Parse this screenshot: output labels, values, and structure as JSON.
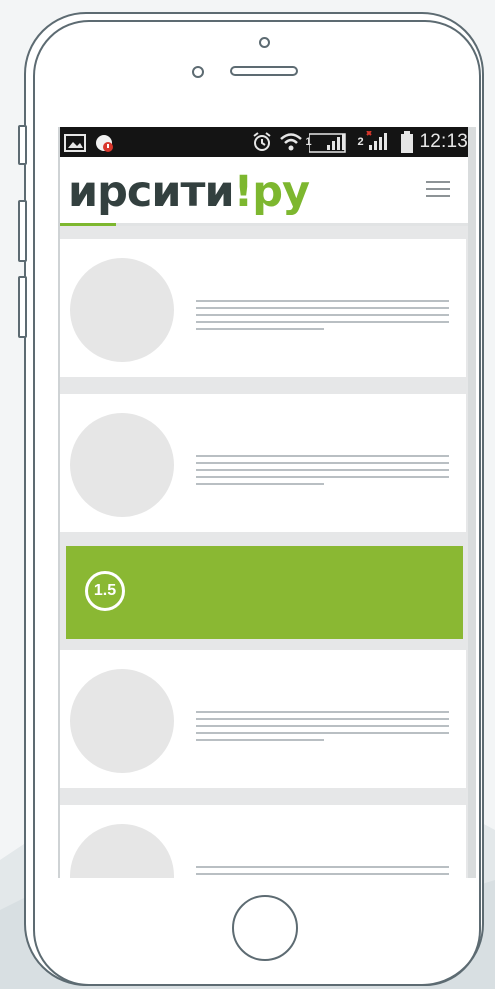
{
  "status_bar": {
    "time": "12:13",
    "sim1_label": "1",
    "sim2_label": "2",
    "icons": [
      "image-icon",
      "notification-icon",
      "alarm-icon",
      "wifi-icon",
      "signal-sim1-icon",
      "signal-sim2-icon",
      "battery-icon"
    ]
  },
  "header": {
    "logo_part1": "ирсити",
    "logo_part2": "!",
    "logo_part3": "ру",
    "menu_icon": "hamburger-menu-icon"
  },
  "promo": {
    "badge": "1.5"
  },
  "colors": {
    "accent": "#8ab833",
    "logo_green": "#7db72f",
    "logo_dark": "#33403f",
    "status_bar": "#141414",
    "placeholder": "#e6e6e6",
    "line": "#b9bfc3",
    "phone_outline": "#5d6b72"
  }
}
